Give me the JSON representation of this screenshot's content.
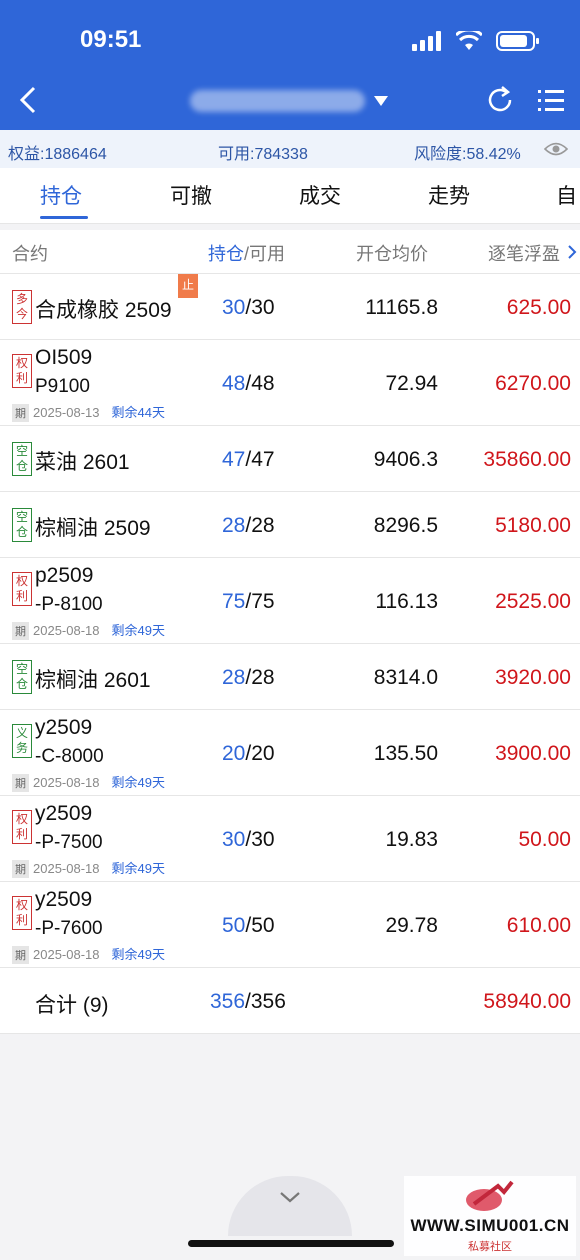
{
  "status": {
    "time": "09:51"
  },
  "nav": {
    "back_icon": "chevron-left-icon",
    "refresh_icon": "refresh-icon",
    "menu_icon": "list-menu-icon"
  },
  "account": {
    "equity": "权益:1886464",
    "available": "可用:784338",
    "risk": "风险度:58.42%"
  },
  "tabs": [
    "持仓",
    "可撤",
    "成交",
    "走势",
    "自"
  ],
  "columns": {
    "contract": "合约",
    "hold": "持仓",
    "sep_avail": "/可用",
    "avg_price": "开仓均价",
    "pnl": "逐笔浮盈"
  },
  "rows": [
    {
      "tag": "多今",
      "name": "合成橡胶 2509",
      "held": "30",
      "avail": "/30",
      "price": "11165.8",
      "pnl": "625.00",
      "badge": "止"
    },
    {
      "tag": "权利",
      "name": "OI509",
      "name2": "P9100",
      "qi": "期",
      "date": "2025-08-13",
      "remain": "剩余44天",
      "held": "48",
      "avail": "/48",
      "price": "72.94",
      "pnl": "6270.00"
    },
    {
      "tag": "空仓",
      "name": "菜油 2601",
      "held": "47",
      "avail": "/47",
      "price": "9406.3",
      "pnl": "35860.00"
    },
    {
      "tag": "空仓",
      "name": "棕榈油 2509",
      "held": "28",
      "avail": "/28",
      "price": "8296.5",
      "pnl": "5180.00"
    },
    {
      "tag": "权利",
      "name": "p2509",
      "name2": "-P-8100",
      "qi": "期",
      "date": "2025-08-18",
      "remain": "剩余49天",
      "held": "75",
      "avail": "/75",
      "price": "116.13",
      "pnl": "2525.00"
    },
    {
      "tag": "空仓",
      "name": "棕榈油 2601",
      "held": "28",
      "avail": "/28",
      "price": "8314.0",
      "pnl": "3920.00"
    },
    {
      "tag": "义务",
      "name": "y2509",
      "name2": "-C-8000",
      "qi": "期",
      "date": "2025-08-18",
      "remain": "剩余49天",
      "held": "20",
      "avail": "/20",
      "price": "135.50",
      "pnl": "3900.00"
    },
    {
      "tag": "权利",
      "name": "y2509",
      "name2": "-P-7500",
      "qi": "期",
      "date": "2025-08-18",
      "remain": "剩余49天",
      "held": "30",
      "avail": "/30",
      "price": "19.83",
      "pnl": "50.00"
    },
    {
      "tag": "权利",
      "name": "y2509",
      "name2": "-P-7600",
      "qi": "期",
      "date": "2025-08-18",
      "remain": "剩余49天",
      "held": "50",
      "avail": "/50",
      "price": "29.78",
      "pnl": "610.00"
    }
  ],
  "total": {
    "label": "合计 (9)",
    "held": "356",
    "avail": "/356",
    "pnl": "58940.00"
  },
  "watermark": {
    "text": "WWW.SIMU001.CN",
    "sub": "私募社区"
  }
}
